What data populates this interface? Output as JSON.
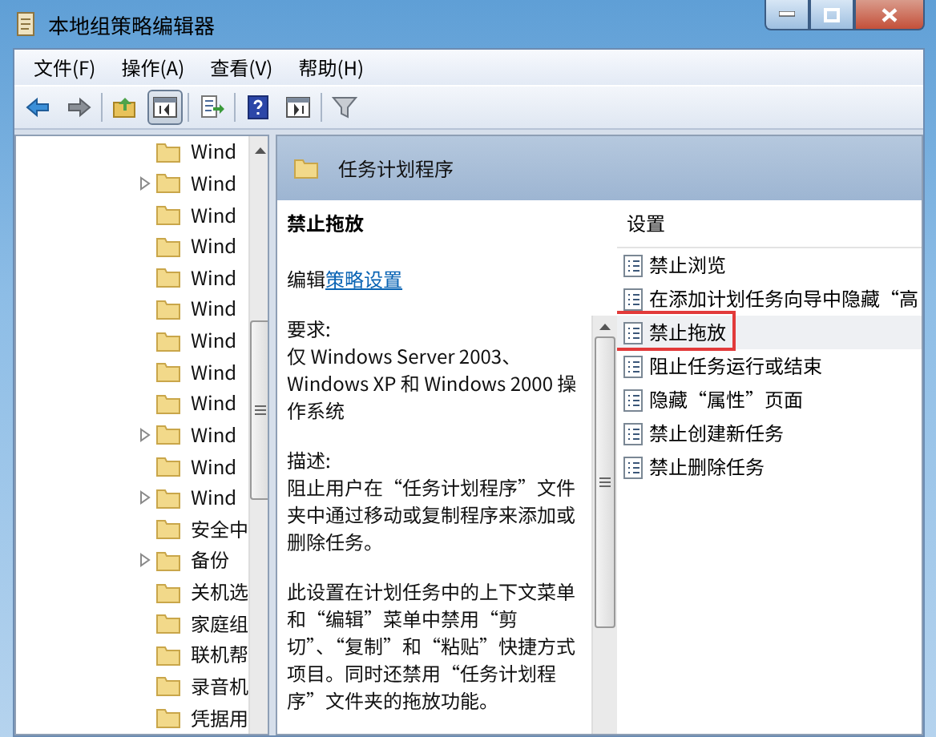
{
  "window": {
    "title": "本地组策略编辑器",
    "buttons": [
      {
        "kind": "minimize"
      },
      {
        "kind": "maximize"
      },
      {
        "kind": "close"
      }
    ]
  },
  "menu": [
    "文件(F)",
    "操作(A)",
    "查看(V)",
    "帮助(H)"
  ],
  "toolbar": [
    {
      "kind": "back",
      "pressed": false
    },
    {
      "kind": "forward",
      "pressed": false
    },
    {
      "kind": "sep"
    },
    {
      "kind": "up",
      "pressed": false
    },
    {
      "kind": "tree",
      "pressed": true
    },
    {
      "kind": "sep"
    },
    {
      "kind": "export",
      "pressed": false
    },
    {
      "kind": "sep"
    },
    {
      "kind": "help",
      "pressed": false
    },
    {
      "kind": "pane",
      "pressed": false
    },
    {
      "kind": "sep"
    },
    {
      "kind": "filter",
      "pressed": false
    }
  ],
  "tree": [
    {
      "label": "Wind",
      "has_children": false
    },
    {
      "label": "Wind",
      "has_children": true
    },
    {
      "label": "Wind",
      "has_children": false
    },
    {
      "label": "Wind",
      "has_children": false
    },
    {
      "label": "Wind",
      "has_children": false
    },
    {
      "label": "Wind",
      "has_children": false
    },
    {
      "label": "Wind",
      "has_children": false
    },
    {
      "label": "Wind",
      "has_children": false
    },
    {
      "label": "Wind",
      "has_children": false
    },
    {
      "label": "Wind",
      "has_children": true
    },
    {
      "label": "Wind",
      "has_children": false
    },
    {
      "label": "Wind",
      "has_children": true
    },
    {
      "label": "安全中",
      "has_children": false
    },
    {
      "label": "备份",
      "has_children": true
    },
    {
      "label": "关机选",
      "has_children": false
    },
    {
      "label": "家庭组",
      "has_children": false
    },
    {
      "label": "联机帮",
      "has_children": false
    },
    {
      "label": "录音机",
      "has_children": false
    },
    {
      "label": "凭据用",
      "has_children": false
    }
  ],
  "folder_header": "任务计划程序",
  "description": {
    "title": "禁止拖放",
    "edit_prefix": "编辑",
    "edit_link": "策略设置",
    "requirements_label": "要求:",
    "requirements": "仅 Windows Server 2003、Windows XP 和 Windows 2000 操作系统",
    "description_label": "描述:",
    "paragraphs": [
      "阻止用户在“任务计划程序”文件夹中通过移动或复制程序来添加或删除任务。",
      "此设置在计划任务中的上下文菜单和“编辑”菜单中禁用“剪切”、“复制”和“粘贴”快捷方式项目。同时还禁用“任务计划程序”文件夹的拖放功能。"
    ]
  },
  "settings": {
    "column": "设置",
    "items": [
      {
        "label": "禁止浏览",
        "selected": false,
        "outlined": false
      },
      {
        "label": "在添加计划任务向导中隐藏“高",
        "selected": false,
        "outlined": false
      },
      {
        "label": "禁止拖放",
        "selected": true,
        "outlined": true
      },
      {
        "label": "阻止任务运行或结束",
        "selected": false,
        "outlined": false
      },
      {
        "label": "隐藏“属性”页面",
        "selected": false,
        "outlined": false
      },
      {
        "label": "禁止创建新任务",
        "selected": false,
        "outlined": false
      },
      {
        "label": "禁止删除任务",
        "selected": false,
        "outlined": false
      }
    ]
  }
}
